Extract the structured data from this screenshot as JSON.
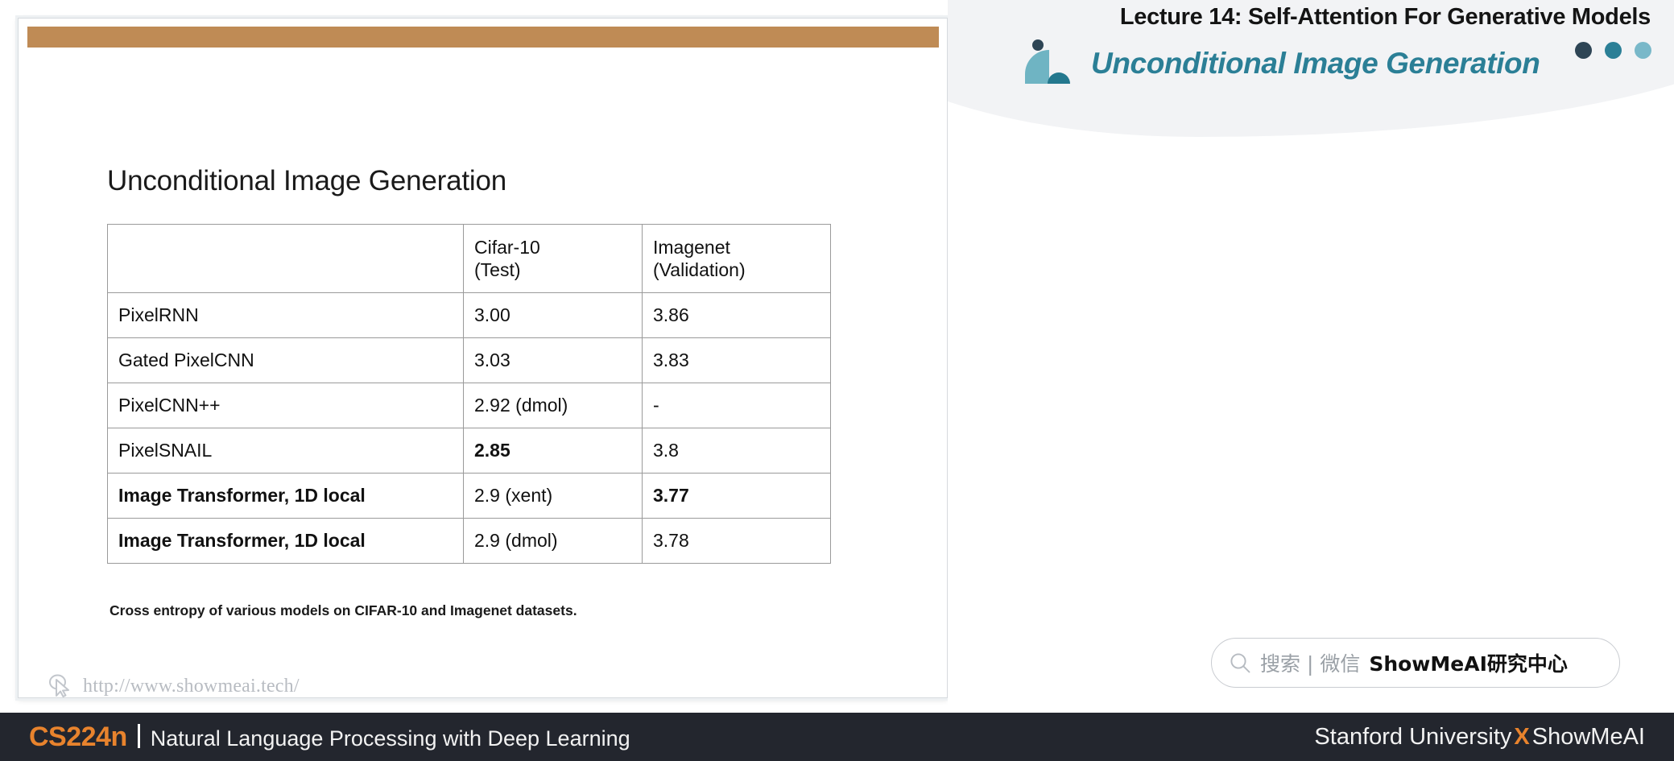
{
  "header": {
    "lecture_title": "Lecture 14:  Self-Attention For Generative Models",
    "logo_text": "Unconditional Image Generation",
    "dot_colors": [
      "#2e4555",
      "#2b7f96",
      "#79b8c9"
    ],
    "curve_color": "#f2f3f5"
  },
  "slide": {
    "topbar_color": "#bf8b55",
    "title": "Unconditional Image Generation",
    "caption": "Cross entropy of various models on CIFAR-10 and Imagenet datasets.",
    "url": "http://www.showmeai.tech/",
    "cursor_icon": "cursor-pointer-icon"
  },
  "table": {
    "headers": [
      {
        "line1": "",
        "line2": ""
      },
      {
        "line1": "Cifar-10",
        "line2": "(Test)"
      },
      {
        "line1": "Imagenet",
        "line2": "(Validation)"
      }
    ],
    "rows": [
      {
        "model": "PixelRNN",
        "model_bold": false,
        "cifar": "3.00",
        "cifar_bold": false,
        "imagenet": "3.86",
        "imagenet_bold": false
      },
      {
        "model": "Gated PixelCNN",
        "model_bold": false,
        "cifar": "3.03",
        "cifar_bold": false,
        "imagenet": "3.83",
        "imagenet_bold": false
      },
      {
        "model": "PixelCNN++",
        "model_bold": false,
        "cifar": "2.92 (dmol)",
        "cifar_bold": false,
        "imagenet": "-",
        "imagenet_bold": false
      },
      {
        "model": "PixelSNAIL",
        "model_bold": false,
        "cifar": "2.85",
        "cifar_bold": true,
        "imagenet": "3.8",
        "imagenet_bold": false
      },
      {
        "model": "Image Transformer, 1D local",
        "model_bold": true,
        "cifar": "2.9 (xent)",
        "cifar_bold": false,
        "imagenet": "3.77",
        "imagenet_bold": true
      },
      {
        "model": "Image Transformer, 1D local",
        "model_bold": true,
        "cifar": "2.9 (dmol)",
        "cifar_bold": false,
        "imagenet": "3.78",
        "imagenet_bold": false
      }
    ]
  },
  "search": {
    "icon": "search-icon",
    "gray_text": "搜索 | 微信",
    "bold_text": "ShowMeAI研究中心"
  },
  "footer": {
    "course_code": "CS224n",
    "course_name": "Natural Language Processing with Deep Learning",
    "right_prefix": "Stanford University",
    "right_x": "X",
    "right_suffix": "ShowMeAI",
    "background": "#23262e",
    "accent": "#e8832d"
  }
}
